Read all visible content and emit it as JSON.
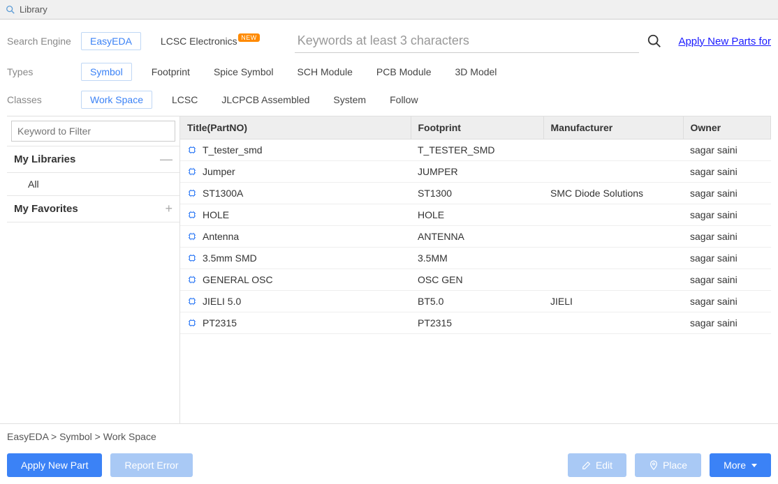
{
  "window": {
    "title": "Library"
  },
  "filters": {
    "search_engine_label": "Search Engine",
    "search_engines": [
      "EasyEDA",
      "LCSC Electronics"
    ],
    "new_badge": "NEW",
    "types_label": "Types",
    "types": [
      "Symbol",
      "Footprint",
      "Spice Symbol",
      "SCH Module",
      "PCB Module",
      "3D Model"
    ],
    "classes_label": "Classes",
    "classes": [
      "Work Space",
      "LCSC",
      "JLCPCB Assembled",
      "System",
      "Follow"
    ]
  },
  "search": {
    "placeholder": "Keywords at least 3 characters",
    "apply_link": "Apply New Parts for"
  },
  "sidebar": {
    "filter_placeholder": "Keyword to Filter",
    "my_libraries": "My Libraries",
    "all": "All",
    "my_favorites": "My Favorites"
  },
  "table": {
    "headers": {
      "title": "Title(PartNO)",
      "footprint": "Footprint",
      "manufacturer": "Manufacturer",
      "owner": "Owner"
    },
    "rows": [
      {
        "title": "T_tester_smd",
        "footprint": "T_TESTER_SMD",
        "manufacturer": "",
        "owner": "sagar saini"
      },
      {
        "title": "Jumper",
        "footprint": "JUMPER",
        "manufacturer": "",
        "owner": "sagar saini"
      },
      {
        "title": "ST1300A",
        "footprint": "ST1300",
        "manufacturer": "SMC Diode Solutions",
        "owner": "sagar saini"
      },
      {
        "title": "HOLE",
        "footprint": "HOLE",
        "manufacturer": "",
        "owner": "sagar saini"
      },
      {
        "title": "Antenna",
        "footprint": "ANTENNA",
        "manufacturer": "",
        "owner": "sagar saini"
      },
      {
        "title": "3.5mm SMD",
        "footprint": "3.5MM",
        "manufacturer": "",
        "owner": "sagar saini"
      },
      {
        "title": "GENERAL OSC",
        "footprint": "OSC GEN",
        "manufacturer": "",
        "owner": "sagar saini"
      },
      {
        "title": "JIELI 5.0",
        "footprint": "BT5.0",
        "manufacturer": "JIELI",
        "owner": "sagar saini"
      },
      {
        "title": "PT2315",
        "footprint": "PT2315",
        "manufacturer": "",
        "owner": "sagar saini"
      }
    ]
  },
  "breadcrumb": "EasyEDA > Symbol > Work Space",
  "actions": {
    "apply_new_part": "Apply New Part",
    "report_error": "Report Error",
    "edit": "Edit",
    "place": "Place",
    "more": "More"
  }
}
